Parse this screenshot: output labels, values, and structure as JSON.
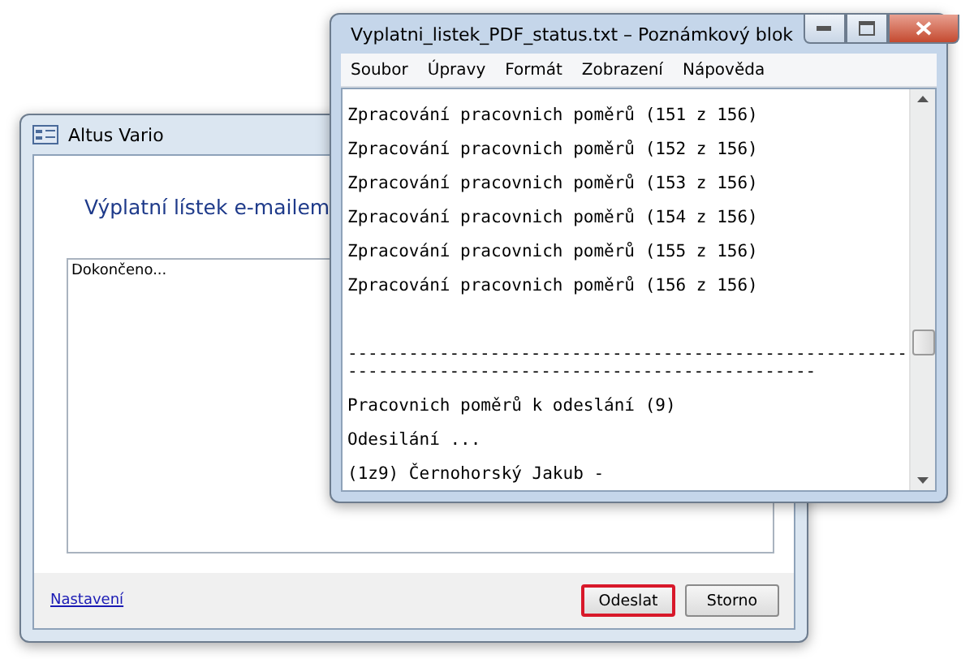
{
  "dialog_window": {
    "title": "Altus Vario",
    "heading": "Výplatní lístek e-mailem",
    "log_text": "Dokončeno...",
    "settings_link": "Nastavení",
    "buttons": [
      {
        "label": "Odeslat",
        "highlighted": true
      },
      {
        "label": "Storno",
        "highlighted": false
      }
    ]
  },
  "notepad_window": {
    "title": "Vyplatni_listek_PDF_status.txt – Poznámkový blok",
    "menu": [
      "Soubor",
      "Úpravy",
      "Formát",
      "Zobrazení",
      "Nápověda"
    ],
    "lines": [
      {
        "kind": "text",
        "text": "Zpracování pracovnich poměrů (151 z 156)"
      },
      {
        "kind": "text",
        "text": "Zpracování pracovnich poměrů (152 z 156)"
      },
      {
        "kind": "text",
        "text": "Zpracování pracovnich poměrů (153 z 156)"
      },
      {
        "kind": "text",
        "text": "Zpracování pracovnich poměrů (154 z 156)"
      },
      {
        "kind": "text",
        "text": "Zpracování pracovnich poměrů (155 z 156)"
      },
      {
        "kind": "text",
        "text": "Zpracování pracovnich poměrů (156 z 156)"
      },
      {
        "kind": "rule",
        "text": "-------------------------------------------------------"
      },
      {
        "kind": "rule",
        "text": "----------------------------------------------"
      },
      {
        "kind": "text",
        "text": "Pracovnich poměrů k odeslání (9)"
      },
      {
        "kind": "text",
        "text": "Odesilání ..."
      },
      {
        "kind": "text",
        "text": "(1z9) Černohorský Jakub -"
      }
    ]
  }
}
